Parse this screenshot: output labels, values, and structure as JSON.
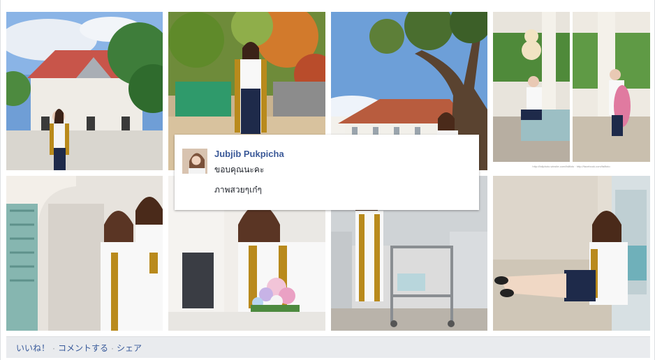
{
  "comment_popup": {
    "author": "Jubjib Pukpicha",
    "line1": "ขอบคุณนะคะ",
    "line2": "ภาพสวยๆเก๋ๆ"
  },
  "footer": {
    "like": "いいね！",
    "comment": "コメントする",
    "share": "シェア",
    "separator": "·"
  },
  "photo_watermark": "http://fallphoto.wixsite.com/fallfoto  http://facebook.com/fallfoto"
}
